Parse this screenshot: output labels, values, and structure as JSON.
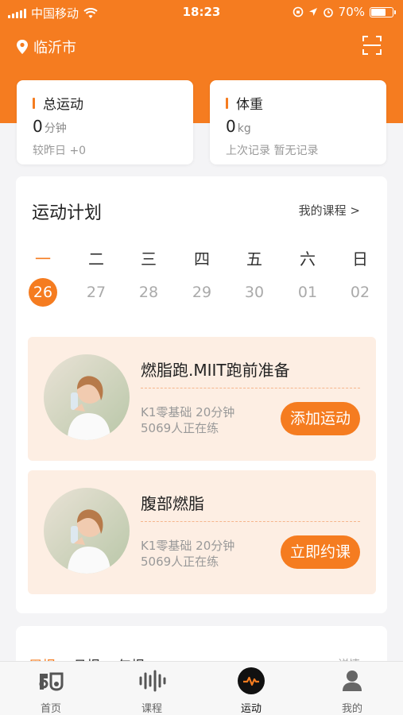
{
  "status_bar": {
    "carrier": "中国移动",
    "time": "18:23",
    "battery": "70%",
    "battery_level": 0.7
  },
  "header": {
    "location": "临沂市"
  },
  "stats": [
    {
      "title": "总运动",
      "value": "0",
      "unit": "分钟",
      "sub": "较昨日 +0"
    },
    {
      "title": "体重",
      "value": "0",
      "unit": "kg",
      "sub": "上次记录 暂无记录"
    }
  ],
  "plan": {
    "title": "运动计划",
    "link": "我的课程 >",
    "weekdays": [
      "一",
      "二",
      "三",
      "四",
      "五",
      "六",
      "日"
    ],
    "dates": [
      "26",
      "27",
      "28",
      "29",
      "30",
      "01",
      "02"
    ],
    "active_index": 0,
    "courses": [
      {
        "title": "燃脂跑.MIIT跑前准备",
        "line1": "K1零基础 20分钟",
        "line2": "5069人正在练",
        "button": "添加运动"
      },
      {
        "title": "腹部燃脂",
        "line1": "K1零基础 20分钟",
        "line2": "5069人正在练",
        "button": "立即约课"
      }
    ]
  },
  "report": {
    "tabs": [
      "周报",
      "月报",
      "年报"
    ],
    "more": "详情"
  },
  "tabbar": [
    {
      "label": "首页",
      "icon": "home-logo-icon"
    },
    {
      "label": "课程",
      "icon": "waveform-icon"
    },
    {
      "label": "运动",
      "icon": "pulse-icon"
    },
    {
      "label": "我的",
      "icon": "person-icon"
    }
  ],
  "colors": {
    "accent": "#f57c20",
    "course_bg": "#fdeee3"
  }
}
